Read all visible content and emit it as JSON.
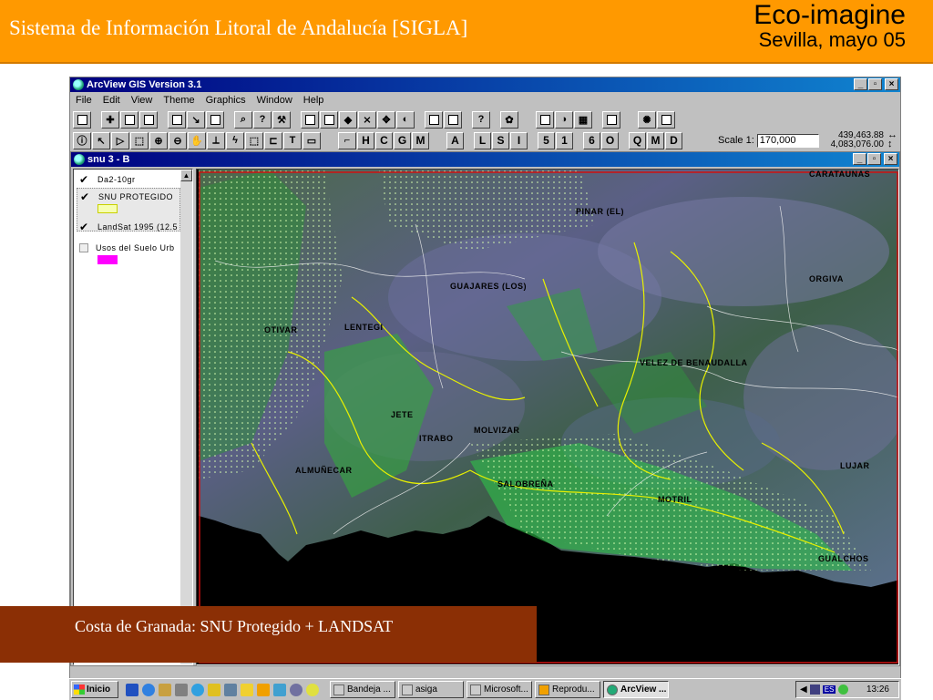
{
  "slide": {
    "title": "Sistema de Información Litoral de Andalucía [SIGLA]",
    "brand": "Eco-imagine",
    "subtitle": "Sevilla, mayo 05",
    "caption": "Costa de Granada: SNU Protegido + LANDSAT",
    "header_color": "#ff9900",
    "caption_color": "#8b2f05"
  },
  "app": {
    "title": "ArcView GIS Version 3.1",
    "menus": [
      "File",
      "Edit",
      "View",
      "Theme",
      "Graphics",
      "Window",
      "Help"
    ],
    "toolbar_letters": [
      "H",
      "C",
      "G",
      "M",
      "A",
      "L",
      "S",
      "I",
      "5",
      "1",
      "6",
      "O",
      "Q",
      "M",
      "D"
    ],
    "scale_label": "Scale 1:",
    "scale_value": "170,000",
    "coord_x": "439,463.88",
    "coord_y": "4,083,076.00",
    "arrow_h": "↔",
    "arrow_v": "↕"
  },
  "view": {
    "title": "snu 3 - B",
    "themes": [
      {
        "label": "Da2-10gr",
        "checked": true
      },
      {
        "label": "SNU PROTEGIDO",
        "checked": true,
        "swatch": "#e6ff60"
      },
      {
        "label": "LandSat 1995 (12.5",
        "checked": true
      },
      {
        "label": "Usos del Suelo Urb",
        "checked": false,
        "swatch": "#ff00ff"
      }
    ],
    "check_mark": "✔",
    "places": [
      "CARATAUNAS",
      "PINAR (EL)",
      "ORGIVA",
      "GUAJARES (LOS)",
      "OTIVAR",
      "LENTEGI",
      "VELEZ DE BENAUDALLA",
      "JETE",
      "ITRABO",
      "MOLVIZAR",
      "ALMUÑECAR",
      "SALOBREÑA",
      "MOTRIL",
      "LUJAR",
      "GUALCHOS"
    ]
  },
  "taskbar": {
    "start": "Inicio",
    "tasks": [
      "Bandeja ...",
      "asiga",
      "Microsoft...",
      "Reprodu...",
      "ArcView ..."
    ],
    "lang": "ES",
    "time": "13:26"
  }
}
